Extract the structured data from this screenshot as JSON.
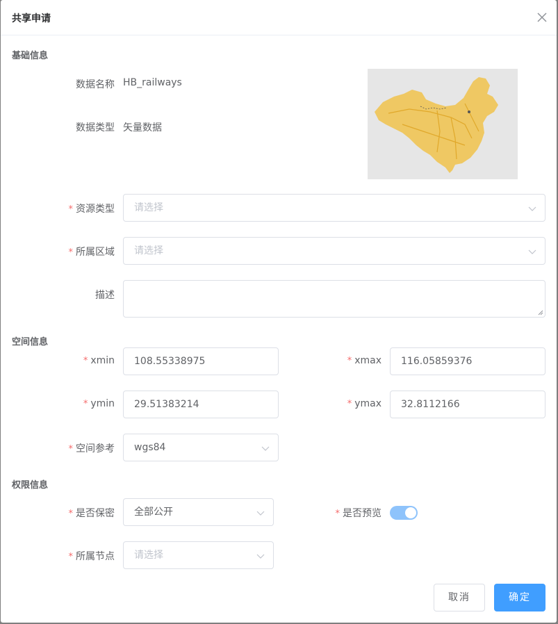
{
  "dialog": {
    "title": "共享申请"
  },
  "sections": {
    "basic": "基础信息",
    "spatial": "空间信息",
    "permission": "权限信息"
  },
  "basic": {
    "name_label": "数据名称",
    "name_value": "HB_railways",
    "type_label": "数据类型",
    "type_value": "矢量数据",
    "resource_type_label": "资源类型",
    "resource_type_placeholder": "请选择",
    "region_label": "所属区域",
    "region_placeholder": "请选择",
    "desc_label": "描述"
  },
  "spatial": {
    "xmin_label": "xmin",
    "xmin_value": "108.55338975",
    "xmax_label": "xmax",
    "xmax_value": "116.05859376",
    "ymin_label": "ymin",
    "ymin_value": "29.51383214",
    "ymax_label": "ymax",
    "ymax_value": "32.8112166",
    "ref_label": "空间参考",
    "ref_value": "wgs84"
  },
  "permission": {
    "secret_label": "是否保密",
    "secret_value": "全部公开",
    "preview_label": "是否预览",
    "preview_on": true,
    "node_label": "所属节点",
    "node_placeholder": "请选择"
  },
  "required_mark": "*",
  "buttons": {
    "cancel": "取消",
    "ok": "确定"
  },
  "colors": {
    "primary": "#409eff",
    "required": "#f56c6c",
    "map_fill": "#f0c24b"
  }
}
